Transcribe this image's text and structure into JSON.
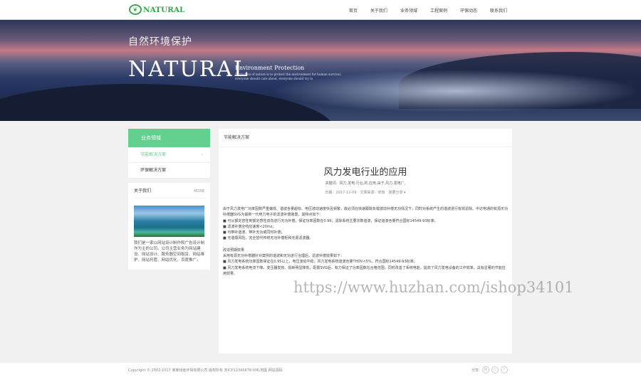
{
  "header": {
    "logo_text": "NATURAL",
    "nav": [
      "首页",
      "关于我们",
      "业务领域",
      "工程案例",
      "环保动态",
      "联系我们"
    ]
  },
  "banner": {
    "cn": "自然环境保护",
    "big": "NATURAL",
    "subtitle": "Environment Protection",
    "desc": "Protection of nature is to protect the environment for human survival, everyone should care about, everyone should try to"
  },
  "sidebar": {
    "title": "业务领域",
    "items": [
      "节能解决方案",
      "环保解决方案"
    ],
    "about_title": "关于我们",
    "more": "MORE",
    "about_text": "我们是一家以网站设计制作和广告设计制作为主的公司。公司主营业务为网站建设、网站设计、服务器空间租赁、网站维护、网站托管、网站优化、百度推广。"
  },
  "main": {
    "breadcrumb": "节能解决方案",
    "title": "风力发电行业的应用",
    "keywords": "关键词：风力,发电,行业,的,应用,由于,风力,发电厂,",
    "meta": "日期：2017-12-09　文章来源：未知　我要分享 ▾",
    "paragraphs": [
      "由于风力发电厂功率因数严重偏低、谐波含量超标、电压波动速度快且频繁，故必须在快速跟踪负载波动补偿无功情况下，同时对系统产生的谐波进行有效滤除。中达电通的有源无功补偿器SVG为最新一代电力电子的滤波补偿装置，其特点如下：",
      "■ 可从额定容性到额定感性双向进行无功补偿，保证功率因数在0.99；滤除系统主要次数谐波，保证谐波含量符合国标14549-93标准；",
      "■ 滤波补偿全响应速度<20ms；",
      "■ 可带补谐波、带补无功或同时补偿；",
      "■ 无谐振风险，完全替代传统无功补偿柜和无源滤波器。"
    ],
    "paragraphs2": [
      "改造预期效果",
      "采用有源无功补偿器针对案例的谐波和无功进行治理后，滤波补偿效果如下：",
      "■ 风力发电系统功率因数保证在0.95以上，电压波动平稳；风力发电系统谐波含量THDV<5%，符合国标14549-93标准；",
      "■ 风力发电系统电流下降，变压器发热、损耗明显降低，配置SVG后，有力保证了功率因数在合格范围，同时改善了系统电能，提高了风力发电设备的工作效率，具有显著的节能应用效果。"
    ]
  },
  "footer": {
    "copyright": "Copyright © 2002-2017 某某绿色环保有限公司 版权所有 苏ICP12345678 XML地图 网站源码",
    "share_label": "分享:"
  },
  "watermark": "https://www.huzhan.com/ishop34101"
}
